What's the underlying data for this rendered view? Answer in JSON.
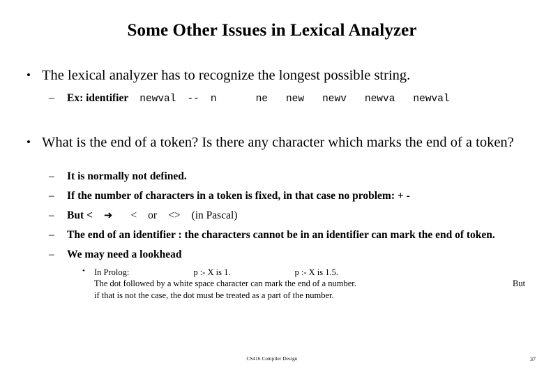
{
  "slide": {
    "title": "Some Other Issues in Lexical Analyzer",
    "bullet1": {
      "marker": "•",
      "text": "The lexical analyzer has to recognize the longest possible string."
    },
    "sub1": {
      "marker": "–",
      "label": "Ex:",
      "emphasis": "identifier",
      "code_tokens": [
        "newval",
        "--",
        "n",
        "ne",
        "new",
        "newv",
        "newva",
        "newval"
      ]
    },
    "bullet2": {
      "marker": "•",
      "text": "What is the end of a token? Is there any character which marks the end of a token?"
    },
    "sub_items": [
      {
        "marker": "–",
        "text": "It is normally not defined."
      },
      {
        "marker": "–",
        "text": "If the number of characters in a token is fixed, in that case no problem:  + -"
      },
      {
        "marker": "–",
        "parts": {
          "before": "But <",
          "arrow": "➜",
          "middle": "<",
          "or": "or",
          "angle": "<>",
          "after": "(in Pascal)"
        }
      },
      {
        "marker": "–",
        "text": "The end of an identifier : the characters cannot be in an identifier can mark the end of token."
      },
      {
        "marker": "–",
        "text": "We may need a lookhead"
      }
    ],
    "prolog": {
      "marker": "•",
      "label": "In Prolog:",
      "example1": "p :- X is 1.",
      "example2": "p :- X is 1.5.",
      "line2": "The dot  followed by a white space character can mark the end of a number.",
      "line2_trailing": "But",
      "line3": "if that is not the case, the dot must be treated as a part of the number."
    }
  },
  "footer": {
    "course": "CS416 Compiler Design",
    "page": "37"
  }
}
